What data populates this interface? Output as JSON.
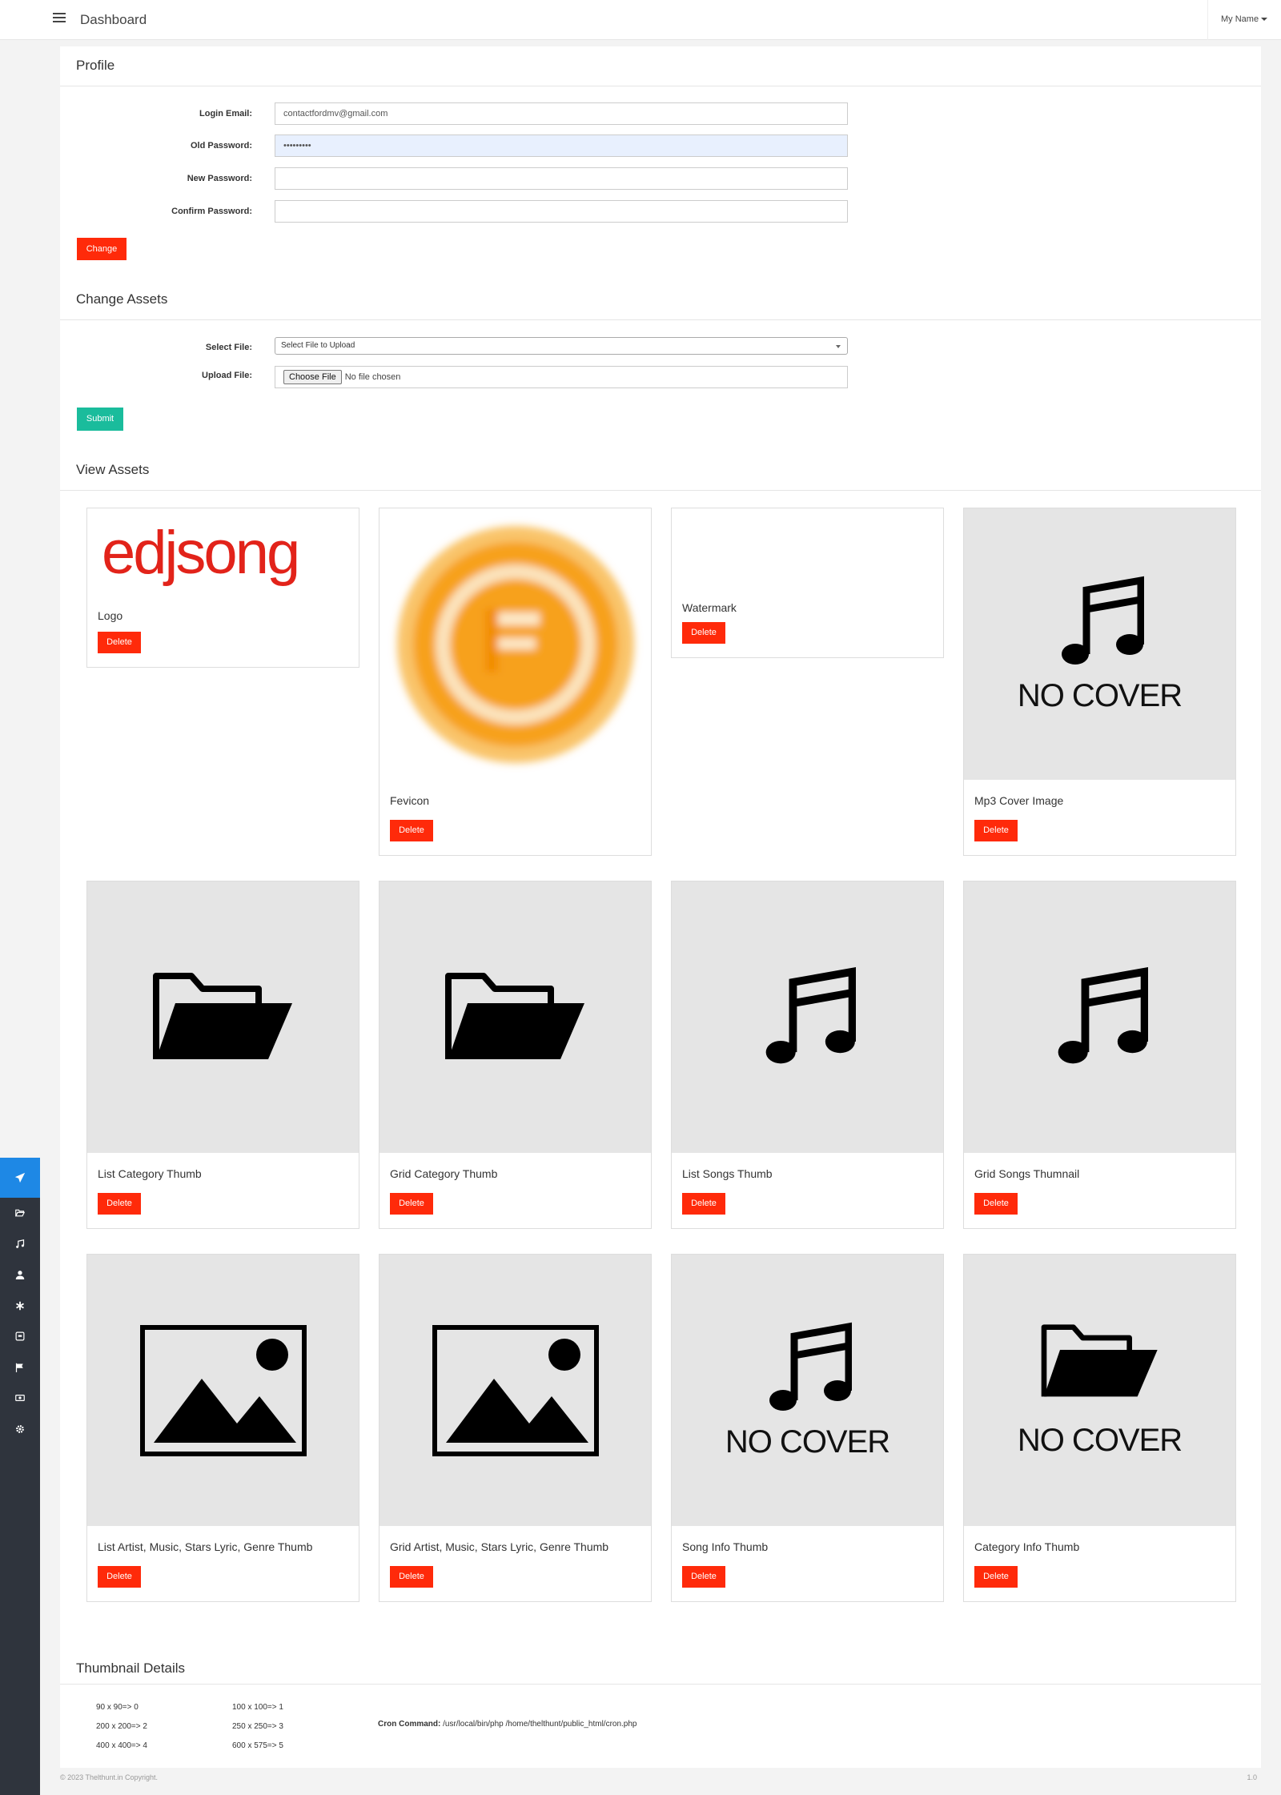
{
  "header": {
    "title": "Dashboard",
    "user_name": "My Name"
  },
  "profile": {
    "title": "Profile",
    "login_email_label": "Login Email:",
    "login_email_value": "contactfordmv@gmail.com",
    "old_password_label": "Old Password:",
    "old_password_value": "•••••••••",
    "new_password_label": "New Password:",
    "confirm_password_label": "Confirm Password:",
    "change_button": "Change"
  },
  "change_assets": {
    "title": "Change Assets",
    "select_file_label": "Select File:",
    "select_file_value": "Select File to Upload",
    "upload_file_label": "Upload File:",
    "choose_file_button": "Choose File",
    "no_file_text": "No file chosen",
    "submit_button": "Submit"
  },
  "view_assets": {
    "title": "View Assets",
    "delete_label": "Delete",
    "logo_text": "edjsong",
    "nocover_text": "NO COVER",
    "cards": [
      {
        "label": "Logo"
      },
      {
        "label": "Fevicon"
      },
      {
        "label": "Watermark"
      },
      {
        "label": "Mp3 Cover Image"
      },
      {
        "label": "List Category Thumb"
      },
      {
        "label": "Grid Category Thumb"
      },
      {
        "label": "List Songs Thumb"
      },
      {
        "label": "Grid Songs Thumnail"
      },
      {
        "label": "List Artist, Music, Stars Lyric, Genre Thumb"
      },
      {
        "label": "Grid Artist, Music, Stars Lyric, Genre Thumb"
      },
      {
        "label": "Song Info Thumb"
      },
      {
        "label": "Category Info Thumb"
      }
    ]
  },
  "thumbnail_details": {
    "title": "Thumbnail Details",
    "items": [
      "90 x 90=> 0",
      "100 x 100=> 1",
      "200 x 200=> 2",
      "250 x 250=> 3",
      "400 x 400=> 4",
      "600 x 575=> 5"
    ],
    "cron_label": "Cron Command:",
    "cron_value": "/usr/local/bin/php /home/thelthunt/public_html/cron.php"
  },
  "footer": {
    "copyright": "© 2023 Thelthunt.in Copyright.",
    "version": "1.0"
  },
  "colors": {
    "danger": "#ff2a0a",
    "success": "#1abc9c",
    "sidebar": "#2f343d",
    "sidebar_active": "#1e88e5",
    "logo_red": "#e2231a",
    "favicon_orange": "#f7a11a"
  },
  "sidebar_icons": [
    "paper-plane-icon",
    "folder-open-icon",
    "music-icon",
    "user-icon",
    "asterisk-icon",
    "box-icon",
    "flag-icon",
    "money-icon",
    "gear-icon"
  ]
}
